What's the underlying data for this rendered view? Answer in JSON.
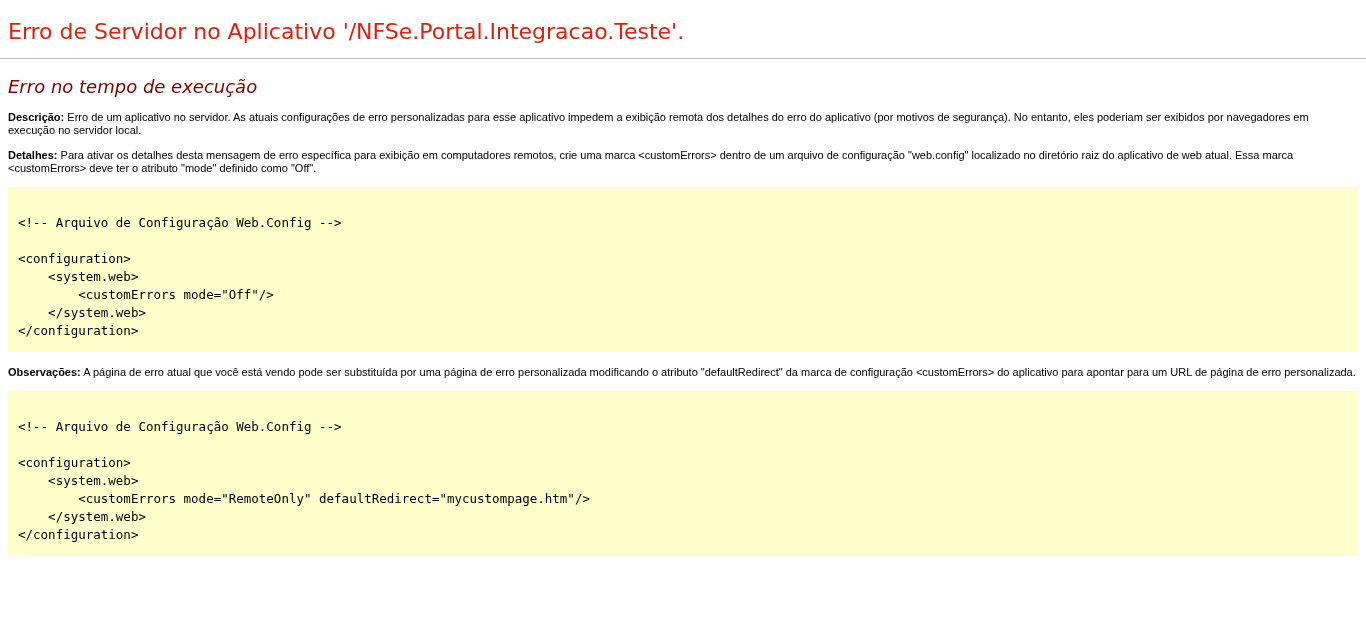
{
  "title": "Erro de Servidor no Aplicativo '/NFSe.Portal.Integracao.Teste'.",
  "subtitle": "Erro no tempo de execução",
  "sections": [
    {
      "kind": "text",
      "text": "**Descrição:** Erro de um aplicativo no servidor. As atuais configurações de erro personalizadas para esse aplicativo impedem a exibição remota dos detalhes do erro do aplicativo (por motivos de segurança). No entanto, eles poderiam ser exibidos por navegadores em execução no servidor local."
    },
    {
      "kind": "text",
      "text": "**Detalhes:** Para ativar os detalhes desta mensagem de erro específica para exibição em computadores remotos, crie uma marca <customErrors> dentro de um arquivo de configuração \"web.config\" localizado no diretório raiz do aplicativo de web atual. Essa marca <customErrors> deve ter o atributo \"mode\" definido como \"Off\"."
    },
    {
      "kind": "code",
      "text": "<!-- Arquivo de Configuração Web.Config -->\n\n<configuration>\n    <system.web>\n        <customErrors mode=\"Off\"/>\n    </system.web>\n</configuration>"
    },
    {
      "kind": "text",
      "text": "**Observações:** A página de erro atual que você está vendo pode ser substituída por uma página de erro personalizada modificando o atributo \"defaultRedirect\" da marca de configuração <customErrors> do aplicativo para apontar para um URL de página de erro personalizada."
    },
    {
      "kind": "code",
      "text": "<!-- Arquivo de Configuração Web.Config -->\n\n<configuration>\n    <system.web>\n        <customErrors mode=\"RemoteOnly\" defaultRedirect=\"mycustompage.htm\"/>\n    </system.web>\n</configuration>"
    }
  ]
}
